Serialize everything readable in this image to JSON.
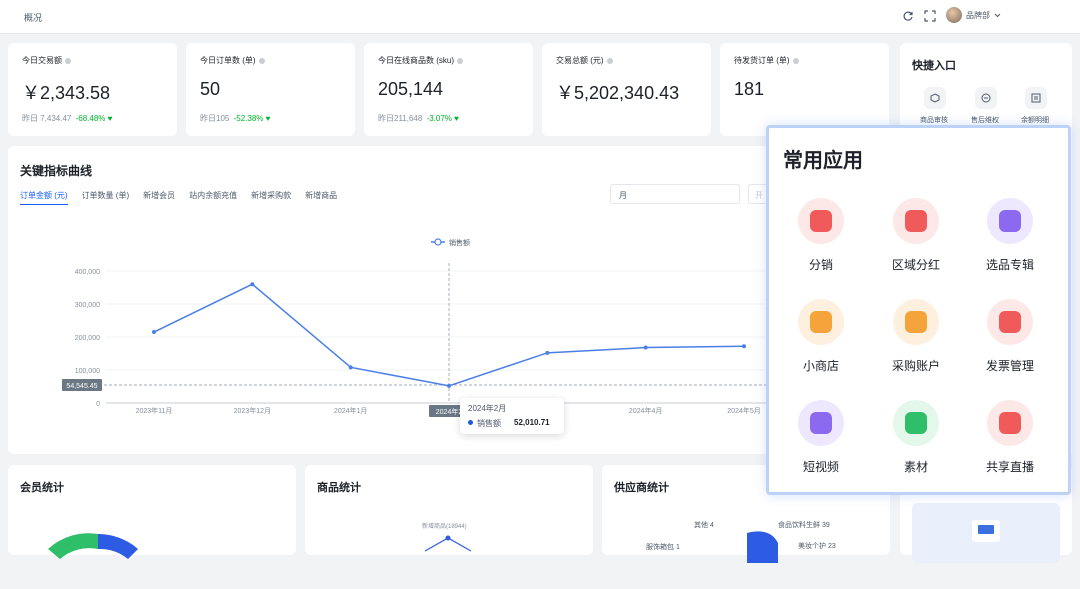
{
  "header": {
    "breadcrumb": "概况",
    "user_name": "品牌部"
  },
  "stats": [
    {
      "label": "今日交易额",
      "value": "￥2,343.58",
      "sub": "昨日 7,434.47",
      "pct": "-68.48%"
    },
    {
      "label": "今日订单数 (单)",
      "value": "50",
      "sub": "昨日105",
      "pct": "-52.38%"
    },
    {
      "label": "今日在线商品数 (sku)",
      "value": "205,144",
      "sub": "昨日211,648",
      "pct": "-3.07%"
    },
    {
      "label": "交易总额 (元)",
      "value": "￥5,202,340.43",
      "sub": "",
      "pct": ""
    },
    {
      "label": "待发货订单 (单)",
      "value": "181",
      "sub": "",
      "pct": ""
    }
  ],
  "quick": {
    "title": "快捷入口",
    "items": [
      "商品审核",
      "售后维权",
      "余额明细"
    ]
  },
  "chart_card": {
    "title": "关键指标曲线",
    "tabs": [
      "订单金额 (元)",
      "订单数量 (单)",
      "新增会员",
      "站内余额充值",
      "新增采购款",
      "新增商品"
    ],
    "period": "月",
    "date_placeholder": "开"
  },
  "chart_data": {
    "type": "line",
    "categories": [
      "2023年11月",
      "2023年12月",
      "2024年1月",
      "2024年2月",
      "2024年3月",
      "2024年4月",
      "2024年5月"
    ],
    "series": [
      {
        "name": "销售额",
        "values": [
          215000,
          360000,
          108000,
          52010.71,
          152000,
          168000,
          172000
        ]
      }
    ],
    "y_ticks": [
      "0",
      "100,000",
      "200,000",
      "300,000",
      "400,000"
    ],
    "ylim": [
      0,
      400000
    ],
    "crosshair_label": "54,545.45",
    "x_crosshair_label": "2024年2",
    "tooltip": {
      "title": "2024年2月",
      "series": "销售额",
      "value": "52,010.71"
    },
    "accent": "#4a7fe6"
  },
  "bottom": {
    "member_title": "会员统计",
    "product_title": "商品统计",
    "supplier_title": "供应商统计",
    "product_label": "新增商品(18944)",
    "supplier_labels": [
      "其他 4",
      "食品饮料生鲜 39",
      "服饰箱包 1",
      "美妆个护 23"
    ]
  },
  "popup": {
    "title": "常用应用",
    "apps": [
      {
        "label": "分销",
        "bg": "#fde8e8",
        "fg": "#f05a5a"
      },
      {
        "label": "区域分红",
        "bg": "#fde8e8",
        "fg": "#f05a5a"
      },
      {
        "label": "选品专辑",
        "bg": "#ede8fd",
        "fg": "#8b6af0"
      },
      {
        "label": "小商店",
        "bg": "#fdf0df",
        "fg": "#f5a33b"
      },
      {
        "label": "采购账户",
        "bg": "#fdf0df",
        "fg": "#f5a33b"
      },
      {
        "label": "发票管理",
        "bg": "#fde8e8",
        "fg": "#f05a5a"
      },
      {
        "label": "短视频",
        "bg": "#ede8fd",
        "fg": "#8b6af0"
      },
      {
        "label": "素材",
        "bg": "#e3f7ea",
        "fg": "#2fbf6a"
      },
      {
        "label": "共享直播",
        "bg": "#fde8e8",
        "fg": "#f05a5a"
      }
    ]
  }
}
